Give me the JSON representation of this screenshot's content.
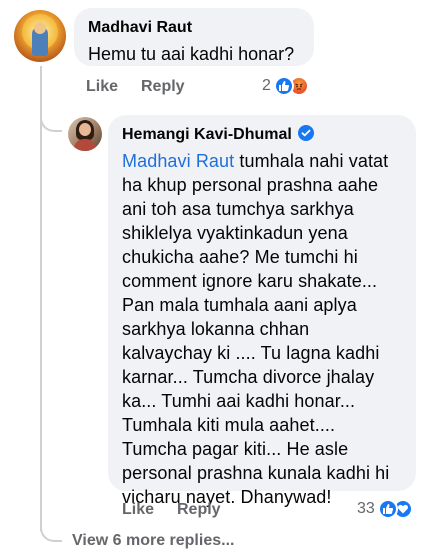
{
  "comment": {
    "author": "Madhavi Raut",
    "text": "Hemu tu aai kadhi honar?",
    "like_label": "Like",
    "reply_label": "Reply",
    "reaction_count": "2",
    "reaction_icons": [
      "like-icon",
      "angry-icon"
    ]
  },
  "reply": {
    "author": "Hemangi Kavi-Dhumal",
    "verified": true,
    "mention": "Madhavi Raut",
    "lines": [
      " tumhala nahi vatat",
      "ha khup personal prashna aahe",
      "ani toh asa tumchya sarkhya",
      "shiklelya vyaktinkadun yena",
      "chukicha aahe? Me tumchi hi",
      "comment ignore karu shakate...",
      "Pan mala tumhala aani aplya",
      "sarkhya lokanna chhan",
      "kalvaychay ki .... Tu lagna kadhi",
      "karnar... Tumcha divorce jhalay",
      "ka... Tumhi aai kadhi honar...",
      "Tumhala kiti mula aahet....",
      "Tumcha pagar kiti... He asle",
      "personal prashna kunala kadhi hi",
      "vicharu nayet. Dhanywad!"
    ],
    "like_label": "Like",
    "reply_label": "Reply",
    "reaction_count": "33",
    "reaction_icons": [
      "like-icon",
      "love-icon"
    ]
  },
  "view_more_label": "View 6 more replies...",
  "colors": {
    "bubble": "#f0f2f5",
    "mention": "#216fdb",
    "secondary_text": "#65676b",
    "like_blue": "#1877f2"
  }
}
